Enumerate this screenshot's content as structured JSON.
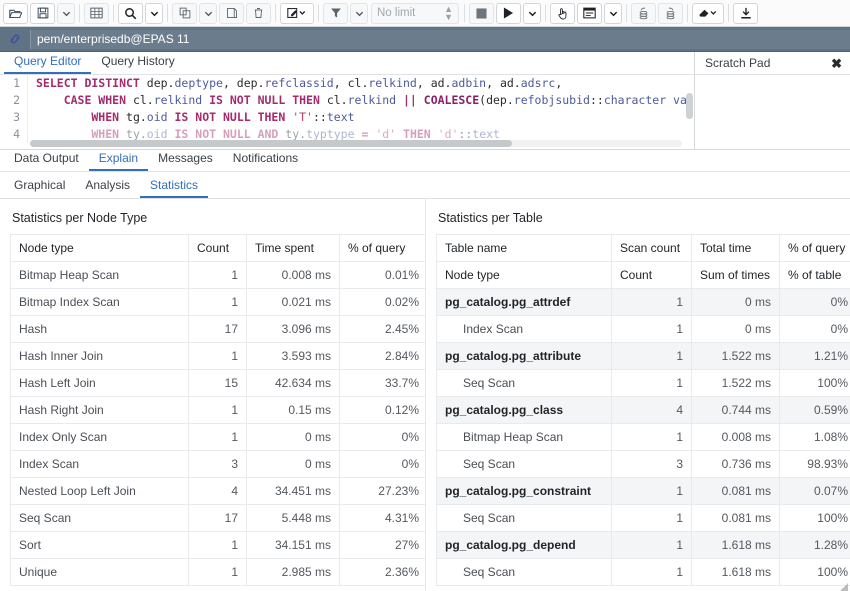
{
  "toolbar": {
    "items": [
      {
        "name": "open-file-icon",
        "glyph": "open-folder"
      },
      {
        "name": "save-file-icon",
        "glyph": "floppy"
      },
      {
        "name": "save-dropdown-caret",
        "glyph": "caret"
      },
      {
        "name": "edit-grid-icon",
        "glyph": "grid"
      },
      {
        "name": "find-icon",
        "glyph": "magnifier"
      },
      {
        "name": "find-dropdown-caret",
        "glyph": "caret"
      },
      {
        "name": "copy-icon",
        "glyph": "copy"
      },
      {
        "name": "copy-dropdown-caret",
        "glyph": "caret"
      },
      {
        "name": "paste-icon",
        "glyph": "paste"
      },
      {
        "name": "delete-row-icon",
        "glyph": "trash"
      },
      {
        "name": "edit-icon",
        "glyph": "pencil-square"
      },
      {
        "name": "filter-icon",
        "glyph": "funnel"
      },
      {
        "name": "filter-dropdown-caret",
        "glyph": "caret"
      },
      {
        "name": "stop-icon",
        "glyph": "stop"
      },
      {
        "name": "execute-icon",
        "glyph": "play"
      },
      {
        "name": "execute-dropdown-caret",
        "glyph": "caret"
      },
      {
        "name": "explain-icon",
        "glyph": "hand"
      },
      {
        "name": "explain-analyze-icon",
        "glyph": "window"
      },
      {
        "name": "explain-dropdown-caret",
        "glyph": "caret"
      },
      {
        "name": "commit-icon",
        "glyph": "commit"
      },
      {
        "name": "rollback-icon",
        "glyph": "rollback"
      },
      {
        "name": "clear-icon",
        "glyph": "eraser"
      },
      {
        "name": "clear-dropdown-caret",
        "glyph": "caret"
      },
      {
        "name": "download-icon",
        "glyph": "download"
      }
    ],
    "row_limit_value": "No limit"
  },
  "connection": {
    "icon": "link-icon",
    "title": "pem/enterprisedb@EPAS 11"
  },
  "editor": {
    "tabs": [
      {
        "label": "Query Editor",
        "active": true
      },
      {
        "label": "Query History",
        "active": false
      }
    ],
    "lines": [
      {
        "number": "1",
        "tokens": [
          {
            "t": "SELECT DISTINCT ",
            "c": "kw"
          },
          {
            "t": "dep.",
            "c": "plain"
          },
          {
            "t": "deptype",
            "c": "id"
          },
          {
            "t": ", dep.",
            "c": "plain"
          },
          {
            "t": "refclassid",
            "c": "id"
          },
          {
            "t": ", cl.",
            "c": "plain"
          },
          {
            "t": "relkind",
            "c": "id"
          },
          {
            "t": ", ad.",
            "c": "plain"
          },
          {
            "t": "adbin",
            "c": "id"
          },
          {
            "t": ", ad.",
            "c": "plain"
          },
          {
            "t": "adsrc",
            "c": "id"
          },
          {
            "t": ",",
            "c": "plain"
          }
        ]
      },
      {
        "number": "2",
        "tokens": [
          {
            "t": "    CASE WHEN ",
            "c": "kw"
          },
          {
            "t": "cl.",
            "c": "plain"
          },
          {
            "t": "relkind",
            "c": "id"
          },
          {
            "t": " IS NOT NULL THEN ",
            "c": "kw"
          },
          {
            "t": "cl.",
            "c": "plain"
          },
          {
            "t": "relkind",
            "c": "id"
          },
          {
            "t": " || ",
            "c": "kw"
          },
          {
            "t": "COALESCE",
            "c": "fn"
          },
          {
            "t": "(dep.",
            "c": "plain"
          },
          {
            "t": "refobjsubid",
            "c": "id"
          },
          {
            "t": "::",
            "c": "plain"
          },
          {
            "t": "character va",
            "c": "id"
          }
        ]
      },
      {
        "number": "3",
        "tokens": [
          {
            "t": "        WHEN ",
            "c": "kw"
          },
          {
            "t": "tg.",
            "c": "plain"
          },
          {
            "t": "oid",
            "c": "id"
          },
          {
            "t": " IS NOT NULL THEN ",
            "c": "kw"
          },
          {
            "t": "'T'",
            "c": "str"
          },
          {
            "t": "::",
            "c": "plain"
          },
          {
            "t": "text",
            "c": "id"
          }
        ]
      },
      {
        "number": "4",
        "tokens": [
          {
            "t": "        WHEN ty.oid IS NOT NULL AND ty.typtype = 'd' THEN 'd'::text",
            "c": "plain"
          }
        ]
      }
    ]
  },
  "scratch_pad": {
    "title": "Scratch Pad",
    "close_label": "✖",
    "content": ""
  },
  "results": {
    "tabs": [
      {
        "label": "Data Output",
        "active": false
      },
      {
        "label": "Explain",
        "active": true
      },
      {
        "label": "Messages",
        "active": false
      },
      {
        "label": "Notifications",
        "active": false
      }
    ],
    "sub_tabs": [
      {
        "label": "Graphical",
        "active": false
      },
      {
        "label": "Analysis",
        "active": false
      },
      {
        "label": "Statistics",
        "active": true
      }
    ]
  },
  "node_type_stats": {
    "title": "Statistics per Node Type",
    "columns": [
      "Node type",
      "Count",
      "Time spent",
      "% of query"
    ],
    "rows": [
      {
        "node": "Bitmap Heap Scan",
        "count": "1",
        "time": "0.008 ms",
        "pct": "0.01%"
      },
      {
        "node": "Bitmap Index Scan",
        "count": "1",
        "time": "0.021 ms",
        "pct": "0.02%"
      },
      {
        "node": "Hash",
        "count": "17",
        "time": "3.096 ms",
        "pct": "2.45%"
      },
      {
        "node": "Hash Inner Join",
        "count": "1",
        "time": "3.593 ms",
        "pct": "2.84%"
      },
      {
        "node": "Hash Left Join",
        "count": "15",
        "time": "42.634 ms",
        "pct": "33.7%"
      },
      {
        "node": "Hash Right Join",
        "count": "1",
        "time": "0.15 ms",
        "pct": "0.12%"
      },
      {
        "node": "Index Only Scan",
        "count": "1",
        "time": "0 ms",
        "pct": "0%"
      },
      {
        "node": "Index Scan",
        "count": "3",
        "time": "0 ms",
        "pct": "0%"
      },
      {
        "node": "Nested Loop Left Join",
        "count": "4",
        "time": "34.451 ms",
        "pct": "27.23%"
      },
      {
        "node": "Seq Scan",
        "count": "17",
        "time": "5.448 ms",
        "pct": "4.31%"
      },
      {
        "node": "Sort",
        "count": "1",
        "time": "34.151 ms",
        "pct": "27%"
      },
      {
        "node": "Unique",
        "count": "1",
        "time": "2.985 ms",
        "pct": "2.36%"
      }
    ]
  },
  "table_stats": {
    "title": "Statistics per Table",
    "columns": [
      "Table name",
      "Scan count",
      "Total time",
      "% of query"
    ],
    "sub_columns": [
      "Node type",
      "Count",
      "Sum of times",
      "% of table"
    ],
    "rows": [
      {
        "kind": "table",
        "name": "pg_catalog.pg_attrdef",
        "count": "1",
        "time": "0 ms",
        "pct": "0%"
      },
      {
        "kind": "node",
        "name": "Index Scan",
        "count": "1",
        "time": "0 ms",
        "pct": "0%"
      },
      {
        "kind": "table",
        "name": "pg_catalog.pg_attribute",
        "count": "1",
        "time": "1.522 ms",
        "pct": "1.21%"
      },
      {
        "kind": "node",
        "name": "Seq Scan",
        "count": "1",
        "time": "1.522 ms",
        "pct": "100%"
      },
      {
        "kind": "table",
        "name": "pg_catalog.pg_class",
        "count": "4",
        "time": "0.744 ms",
        "pct": "0.59%"
      },
      {
        "kind": "node",
        "name": "Bitmap Heap Scan",
        "count": "1",
        "time": "0.008 ms",
        "pct": "1.08%"
      },
      {
        "kind": "node",
        "name": "Seq Scan",
        "count": "3",
        "time": "0.736 ms",
        "pct": "98.93%"
      },
      {
        "kind": "table",
        "name": "pg_catalog.pg_constraint",
        "count": "1",
        "time": "0.081 ms",
        "pct": "0.07%"
      },
      {
        "kind": "node",
        "name": "Seq Scan",
        "count": "1",
        "time": "0.081 ms",
        "pct": "100%"
      },
      {
        "kind": "table",
        "name": "pg_catalog.pg_depend",
        "count": "1",
        "time": "1.618 ms",
        "pct": "1.28%"
      },
      {
        "kind": "node",
        "name": "Seq Scan",
        "count": "1",
        "time": "1.618 ms",
        "pct": "100%"
      }
    ]
  },
  "colors": {
    "accent": "#326fbd",
    "connection_bar": "#5f7384",
    "table_row_shade": "#f3f5f7"
  }
}
